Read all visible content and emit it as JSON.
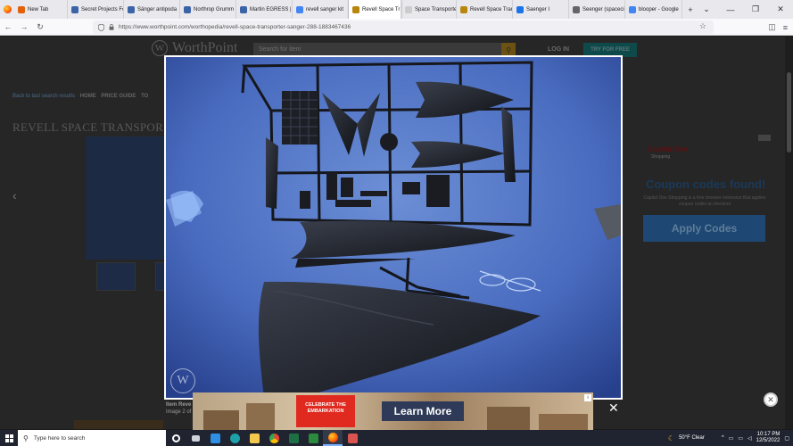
{
  "browser": {
    "tabs": [
      {
        "label": "New Tab",
        "fav": "#e36209",
        "active": false
      },
      {
        "label": "Secret Projects Fo",
        "fav": "#3a63a8",
        "active": false
      },
      {
        "label": "Sänger antipoda",
        "fav": "#3a63a8",
        "active": false
      },
      {
        "label": "Northrop Grumm",
        "fav": "#3a63a8",
        "active": false
      },
      {
        "label": "Martin EGRESS |",
        "fav": "#3a63a8",
        "active": false
      },
      {
        "label": "revell sanger kit",
        "fav": "#4285f4",
        "active": false
      },
      {
        "label": "Revell Space Tr",
        "fav": "#b8860b",
        "active": true
      },
      {
        "label": "Space Transporter Sa",
        "fav": "#cccccc",
        "active": false
      },
      {
        "label": "Revell Space Tran",
        "fav": "#b8860b",
        "active": false
      },
      {
        "label": "Saenger I",
        "fav": "#1a73e8",
        "active": false
      },
      {
        "label": "Seenger (spaceci",
        "fav": "#666666",
        "active": false
      },
      {
        "label": "blooper - Google",
        "fav": "#4285f4",
        "active": false
      }
    ],
    "new_tab": "+",
    "list_tabs": "⌄",
    "minimize": "—",
    "restore": "❐",
    "close": "✕",
    "url": "https://www.worthpoint.com/worthopedia/revell-space-transporter-sanger-288-1883467436"
  },
  "worthpoint": {
    "brand": "WorthPoint",
    "search_placeholder": "Search for item",
    "login": "LOG IN",
    "join": "TRY FOR FREE",
    "crumb_back": "Back to last search results",
    "crumbs": [
      "HOME",
      "PRICE GUIDE",
      "TO"
    ],
    "title": "REVELL SPACE TRANSPOR",
    "item_line": "Item Reve",
    "image_count": "Image 2 of 1"
  },
  "side_ad": {
    "company": "Capital One",
    "company_sub": "Shopping",
    "headline": "Coupon codes found!",
    "subtext": "Capital One Shopping is a free browser extension that applies coupon codes at checkout",
    "cta": "Apply Codes"
  },
  "bottom_ad": {
    "logo_text": "CELEBRATE THE EMBARKATION",
    "cta": "Learn More",
    "close": "✕"
  },
  "taskbar": {
    "search_placeholder": "Type here to search",
    "weather": "50°F  Clear",
    "time": "10:17 PM",
    "date": "12/5/2022"
  }
}
